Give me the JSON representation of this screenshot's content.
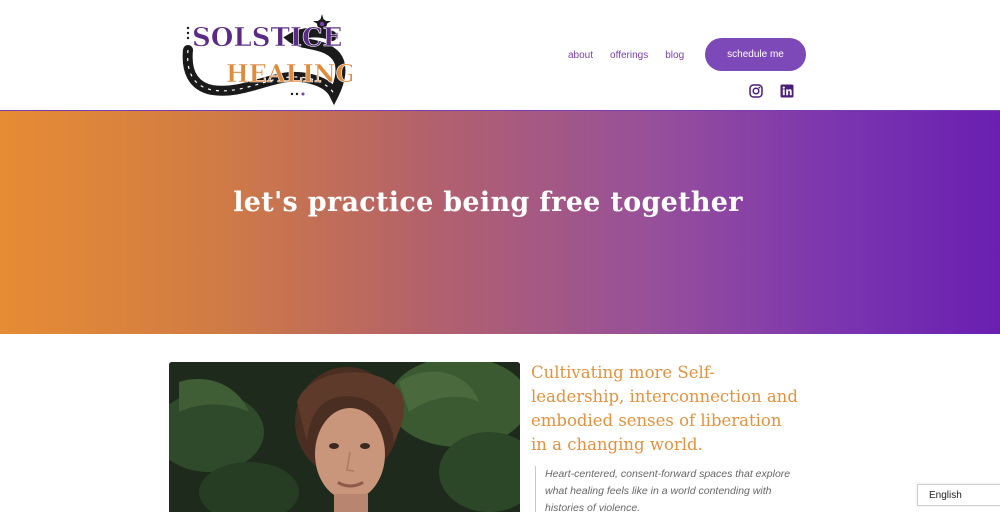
{
  "logo": {
    "line1": "SOLSTICE",
    "line2": "HEALING",
    "colors": {
      "purple": "#5b2a86",
      "orange": "#e08a3c",
      "snake": "#1a1a1a"
    }
  },
  "nav": {
    "items": [
      {
        "label": "about"
      },
      {
        "label": "offerings"
      },
      {
        "label": "blog"
      }
    ],
    "cta_label": "schedule me"
  },
  "social": [
    {
      "icon": "instagram-icon"
    },
    {
      "icon": "linkedin-icon"
    }
  ],
  "hero": {
    "title": "let's practice being free together",
    "gradient": [
      "#e68c34",
      "#b46269",
      "#6a1fb0"
    ]
  },
  "content": {
    "tagline": "Cultivating more Self-leadership, interconnection and embodied senses of liberation in a changing world.",
    "quote": "Heart-centered, consent-forward spaces that explore what healing feels like in a world contending with histories of violence."
  },
  "language": {
    "selected": "English"
  },
  "colors": {
    "accent": "#7d48b8",
    "nav_text": "#7a3db0",
    "tagline": "#e3923f"
  }
}
